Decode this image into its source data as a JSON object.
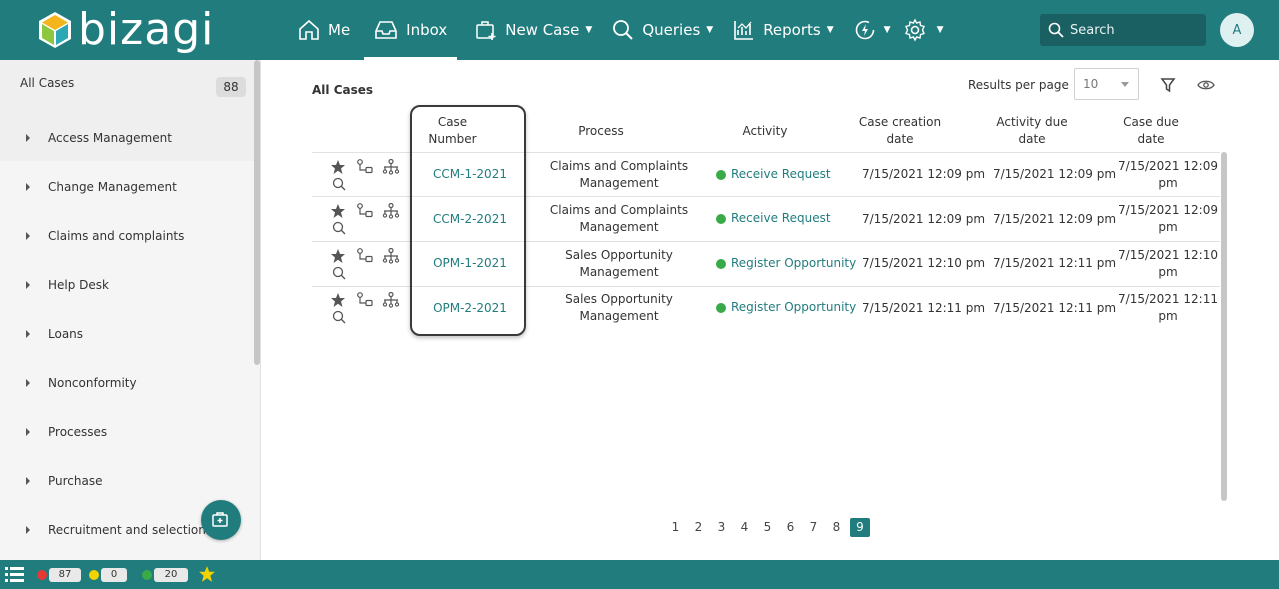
{
  "header": {
    "logo_text": "bizagi",
    "nav": [
      {
        "label": "Me",
        "icon": "home-icon"
      },
      {
        "label": "Inbox",
        "icon": "inbox-icon",
        "active": true
      },
      {
        "label": "New Case",
        "icon": "new-case-icon"
      },
      {
        "label": "Queries",
        "icon": "search-icon"
      },
      {
        "label": "Reports",
        "icon": "chart-icon"
      }
    ],
    "search_placeholder": "Search",
    "avatar_initial": "A"
  },
  "sidebar": {
    "title": "All Cases",
    "count": "88",
    "items": [
      {
        "label": "Access Management"
      },
      {
        "label": "Change Management"
      },
      {
        "label": "Claims and complaints"
      },
      {
        "label": "Help Desk"
      },
      {
        "label": "Loans"
      },
      {
        "label": "Nonconformity"
      },
      {
        "label": "Processes"
      },
      {
        "label": "Purchase"
      },
      {
        "label": "Recruitment and selection"
      }
    ]
  },
  "main": {
    "title": "All Cases",
    "results_per_page_label": "Results per page",
    "results_per_page_value": "10",
    "columns": {
      "case_number": [
        "Case",
        "Number"
      ],
      "process": "Process",
      "activity": "Activity",
      "creation": [
        "Case creation",
        "date"
      ],
      "activity_due": [
        "Activity due",
        "date"
      ],
      "case_due": [
        "Case due",
        "date"
      ]
    },
    "rows": [
      {
        "case": "CCM-1-2021",
        "process": [
          "Claims and Complaints",
          "Management"
        ],
        "activity": "Receive Request",
        "created": "7/15/2021 12:09 pm",
        "activity_due": "7/15/2021 12:09 pm",
        "case_due": [
          "7/15/2021 12:09",
          "pm"
        ]
      },
      {
        "case": "CCM-2-2021",
        "process": [
          "Claims and Complaints",
          "Management"
        ],
        "activity": "Receive Request",
        "created": "7/15/2021 12:09 pm",
        "activity_due": "7/15/2021 12:09 pm",
        "case_due": [
          "7/15/2021 12:09",
          "pm"
        ]
      },
      {
        "case": "OPM-1-2021",
        "process": [
          "Sales Opportunity",
          "Management"
        ],
        "activity": "Register Opportunity",
        "created": "7/15/2021 12:10 pm",
        "activity_due": "7/15/2021 12:11 pm",
        "case_due": [
          "7/15/2021 12:10",
          "pm"
        ]
      },
      {
        "case": "OPM-2-2021",
        "process": [
          "Sales Opportunity",
          "Management"
        ],
        "activity": "Register Opportunity",
        "created": "7/15/2021 12:11 pm",
        "activity_due": "7/15/2021 12:11 pm",
        "case_due": [
          "7/15/2021 12:11",
          "pm"
        ]
      }
    ],
    "pages": [
      "1",
      "2",
      "3",
      "4",
      "5",
      "6",
      "7",
      "8",
      "9"
    ],
    "current_page": "9"
  },
  "footer": {
    "red_count": "87",
    "yellow_count": "0",
    "green_count": "20",
    "colors": {
      "red": "#e53935",
      "yellow": "#f2d200",
      "green": "#3aaa48"
    }
  },
  "colors": {
    "brand": "#217c7e",
    "accent_link": "#217c7e"
  }
}
